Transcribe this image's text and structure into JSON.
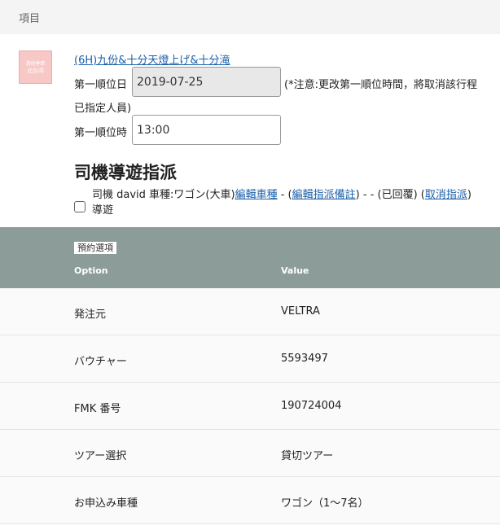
{
  "header": {
    "title": "項目"
  },
  "product": {
    "thumb_text": [
      "満悦季節",
      "北台湾"
    ],
    "title": "(6H)九份&十分天燈上げ&十分滝",
    "date_label": "第一順位日",
    "date_value": "2019-07-25",
    "note": "(*注意:更改第一順位時間，將取消該行程已指定人員)",
    "note_line1": "(*注意:更改第一順位時間，將取消該行程",
    "note_line2": "已指定人員)",
    "time_label": "第一順位時",
    "time_value": "13:00"
  },
  "assignment": {
    "heading": "司機導遊指派",
    "driver_text": "司機 david 車種:ワゴン(大車)",
    "edit_vehicle": "編輯車種",
    "sep1": " - (",
    "edit_note": "編輯指派備註",
    "sep2": ") - - (已回覆) (",
    "cancel": "取消指派",
    "sep3": ")",
    "guide_label": "導遊",
    "guide_checked": false
  },
  "options": {
    "badge": "預約選項",
    "col_option": "Option",
    "col_value": "Value",
    "rows": [
      {
        "option": "発注元",
        "value": "VELTRA"
      },
      {
        "option": "バウチャー",
        "value": "5593497"
      },
      {
        "option": "FMK 番号",
        "value": "190724004"
      },
      {
        "option": "ツアー選択",
        "value": "貸切ツアー"
      },
      {
        "option": "お申込み車種",
        "value": "ワゴン（1〜7名）"
      }
    ]
  }
}
